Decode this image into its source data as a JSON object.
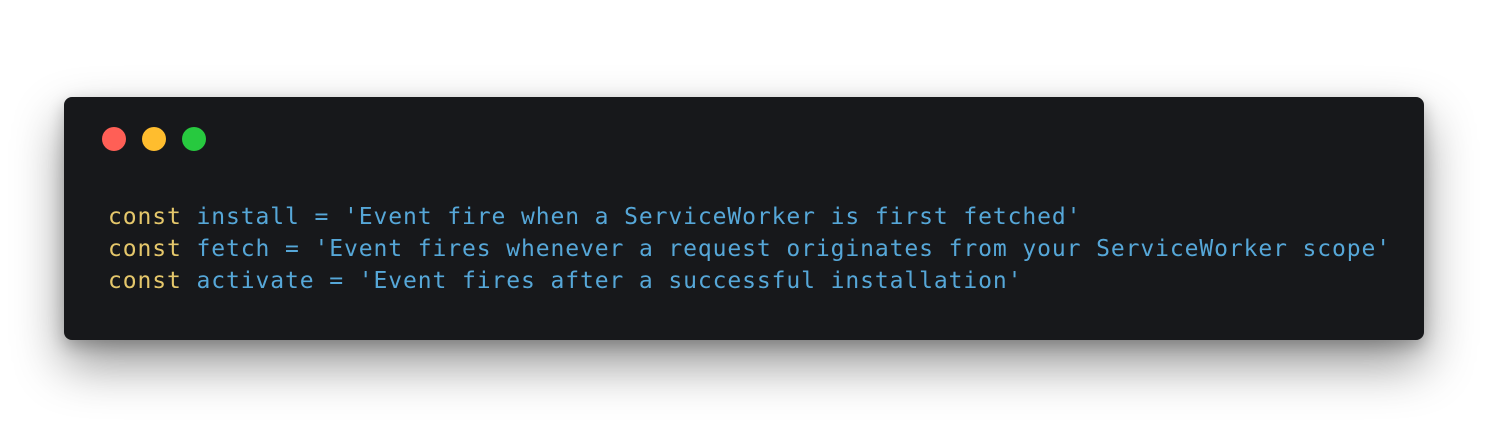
{
  "window": {
    "buttons": [
      {
        "name": "close",
        "color": "#ff5f56"
      },
      {
        "name": "minimize",
        "color": "#ffbd2e"
      },
      {
        "name": "zoom",
        "color": "#27c93f"
      }
    ]
  },
  "code": {
    "lines": [
      {
        "keyword": "const",
        "identifier": "install",
        "operator": "=",
        "string": "'Event fire when a ServiceWorker is first fetched'"
      },
      {
        "keyword": "const",
        "identifier": "fetch",
        "operator": "=",
        "string": "'Event fires whenever a request originates from your ServiceWorker scope'"
      },
      {
        "keyword": "const",
        "identifier": "activate",
        "operator": "=",
        "string": "'Event fires after a successful installation'"
      }
    ]
  },
  "colors": {
    "background": "#17181b",
    "keyword": "#e5c76b",
    "text": "#56a7d8"
  }
}
